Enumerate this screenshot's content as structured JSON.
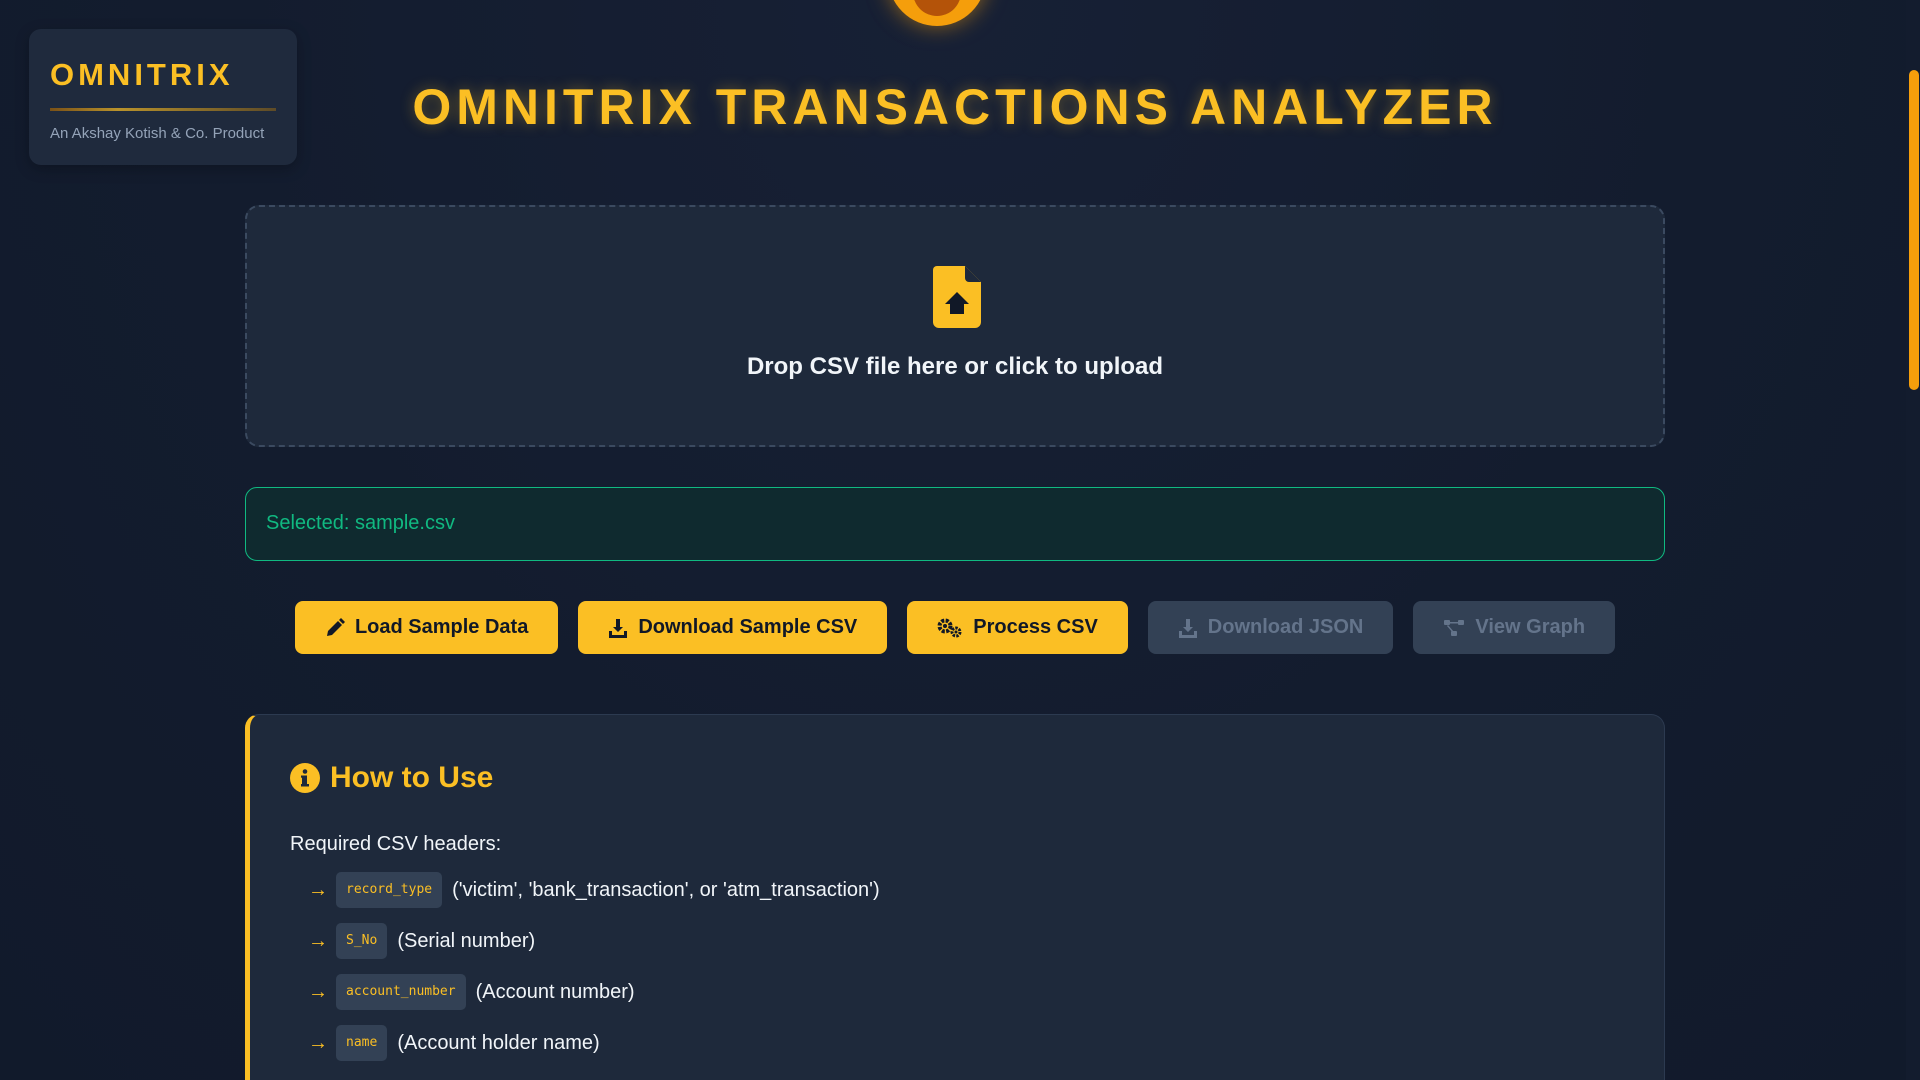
{
  "brand": {
    "name": "OMNITRIX",
    "tagline": "An Akshay Kotish & Co. Product"
  },
  "title": "OMNITRIX TRANSACTIONS ANALYZER",
  "upload": {
    "prompt": "Drop CSV file here or click to upload",
    "icon": "file-upload-icon"
  },
  "selected_file": "Selected: sample.csv",
  "buttons": [
    {
      "label": "Load Sample Data",
      "icon": "pencil-icon",
      "enabled": true
    },
    {
      "label": "Download Sample CSV",
      "icon": "download-icon",
      "enabled": true
    },
    {
      "label": "Process CSV",
      "icon": "gears-icon",
      "enabled": true
    },
    {
      "label": "Download JSON",
      "icon": "download-icon",
      "enabled": false
    },
    {
      "label": "View Graph",
      "icon": "graph-icon",
      "enabled": false
    }
  ],
  "howto": {
    "title": "How to Use",
    "required_label": "Required CSV headers:",
    "headers": [
      {
        "code": "record_type",
        "desc": "('victim', 'bank_transaction', or 'atm_transaction')"
      },
      {
        "code": "S_No",
        "desc": "(Serial number)"
      },
      {
        "code": "account_number",
        "desc": "(Account number)"
      },
      {
        "code": "name",
        "desc": "(Account holder name)"
      }
    ]
  },
  "colors": {
    "accent": "#fbbf24",
    "background": "#131c2e",
    "card": "#1e293b",
    "success": "#10b981",
    "disabled": "#334155"
  }
}
